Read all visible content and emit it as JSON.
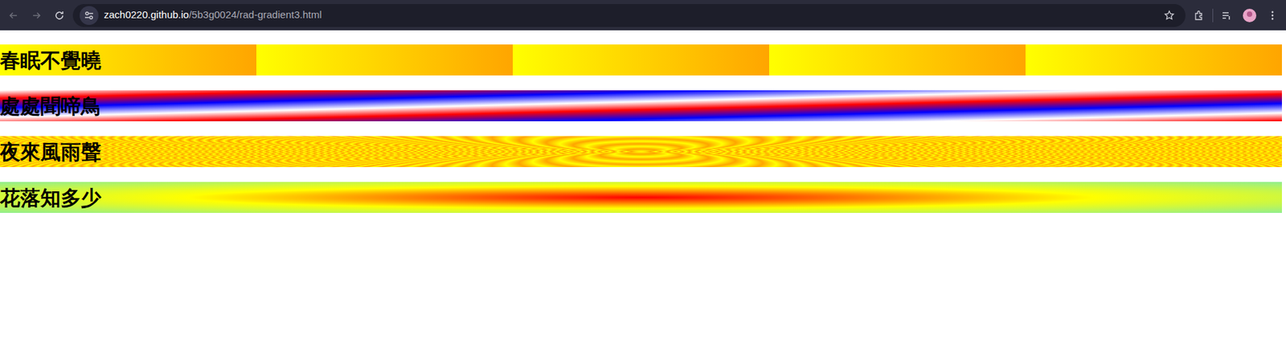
{
  "browser": {
    "url_host": "zach0220.github.io",
    "url_path": "/5b3g0024/rad-gradient3.html"
  },
  "lines": [
    {
      "text": "春眠不覺曉",
      "kind": "stripes"
    },
    {
      "text": "處處聞啼鳥",
      "kind": "diagonal"
    },
    {
      "text": "夜來風雨聲",
      "kind": "rings"
    },
    {
      "text": "花落知多少",
      "kind": "radial"
    }
  ]
}
